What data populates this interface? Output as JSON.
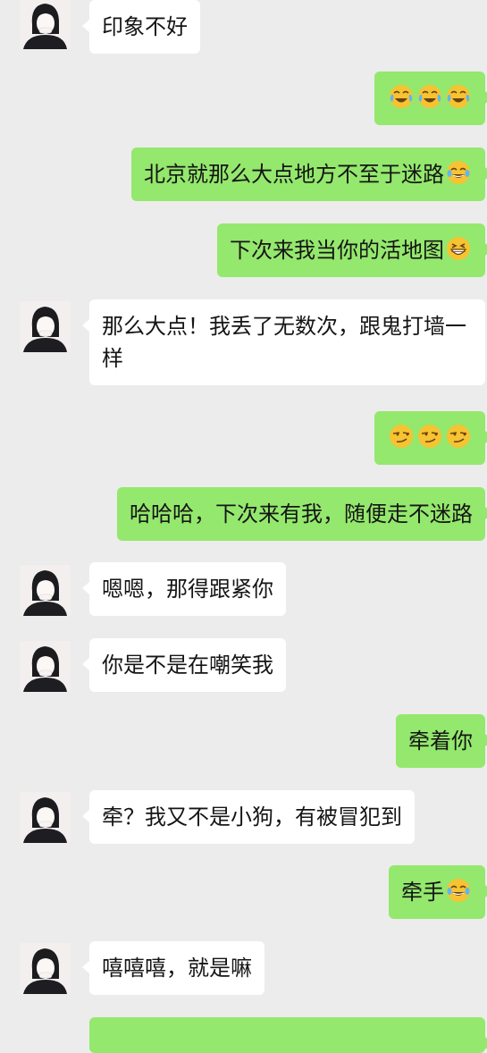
{
  "messages": [
    {
      "side": "in",
      "text": "印象不好",
      "emojis": []
    },
    {
      "side": "out",
      "text": "",
      "emojis": [
        "crying-laughing",
        "crying-laughing",
        "crying-laughing"
      ]
    },
    {
      "side": "out",
      "text": "北京就那么大点地方不至于迷路",
      "emojis": [
        "tears-of-joy"
      ]
    },
    {
      "side": "out",
      "text": "下次来我当你的活地图",
      "emojis": [
        "grinning"
      ]
    },
    {
      "side": "in",
      "text": "那么大点！我丢了无数次，跟鬼打墙一样",
      "emojis": []
    },
    {
      "side": "out",
      "text": "",
      "emojis": [
        "smirk",
        "smirk",
        "smirk"
      ]
    },
    {
      "side": "out",
      "text": "哈哈哈，下次来有我，随便走不迷路",
      "emojis": []
    },
    {
      "side": "in",
      "text": "嗯嗯，那得跟紧你",
      "emojis": []
    },
    {
      "side": "in",
      "text": "你是不是在嘲笑我",
      "emojis": []
    },
    {
      "side": "out",
      "text": "牵着你",
      "emojis": []
    },
    {
      "side": "in",
      "text": "牵？我又不是小狗，有被冒犯到",
      "emojis": []
    },
    {
      "side": "out",
      "text": "牵手",
      "emojis": [
        "tears-of-joy"
      ]
    },
    {
      "side": "in",
      "text": "嘻嘻嘻，就是嘛",
      "emojis": []
    },
    {
      "side": "out",
      "text": "",
      "emojis": []
    }
  ],
  "colors": {
    "background": "#ececec",
    "incoming_bubble": "#ffffff",
    "outgoing_bubble": "#94e86d",
    "emoji_yellow": "#f6c332"
  }
}
